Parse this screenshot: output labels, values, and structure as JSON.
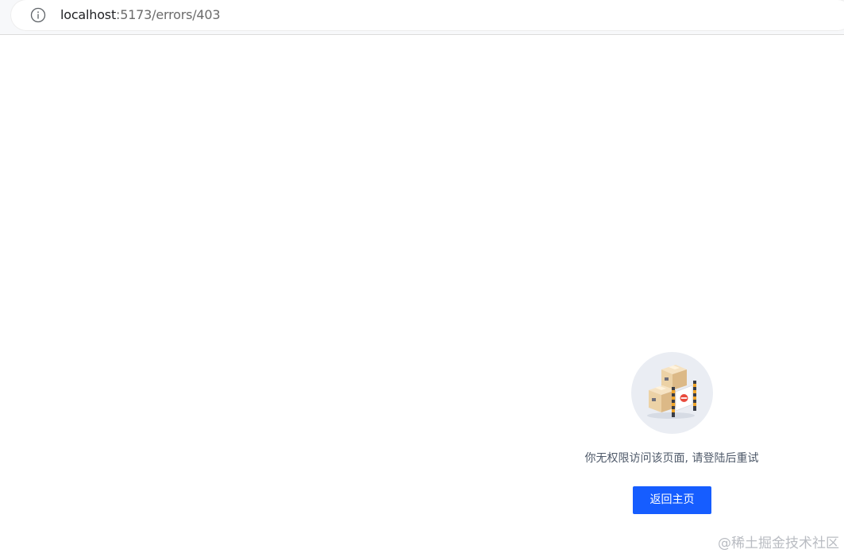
{
  "browser": {
    "url_host": "localhost",
    "url_path": ":5173/errors/403",
    "info_icon": "info-circle-icon"
  },
  "error": {
    "illustration_icon": "boxes-barrier-403-icon",
    "message": "你无权限访问该页面, 请登陆后重试",
    "home_button_label": "返回主页",
    "accent_color": "#165dff",
    "text_color": "#4e5969"
  },
  "watermark": {
    "text": "@稀土掘金技术社区"
  }
}
